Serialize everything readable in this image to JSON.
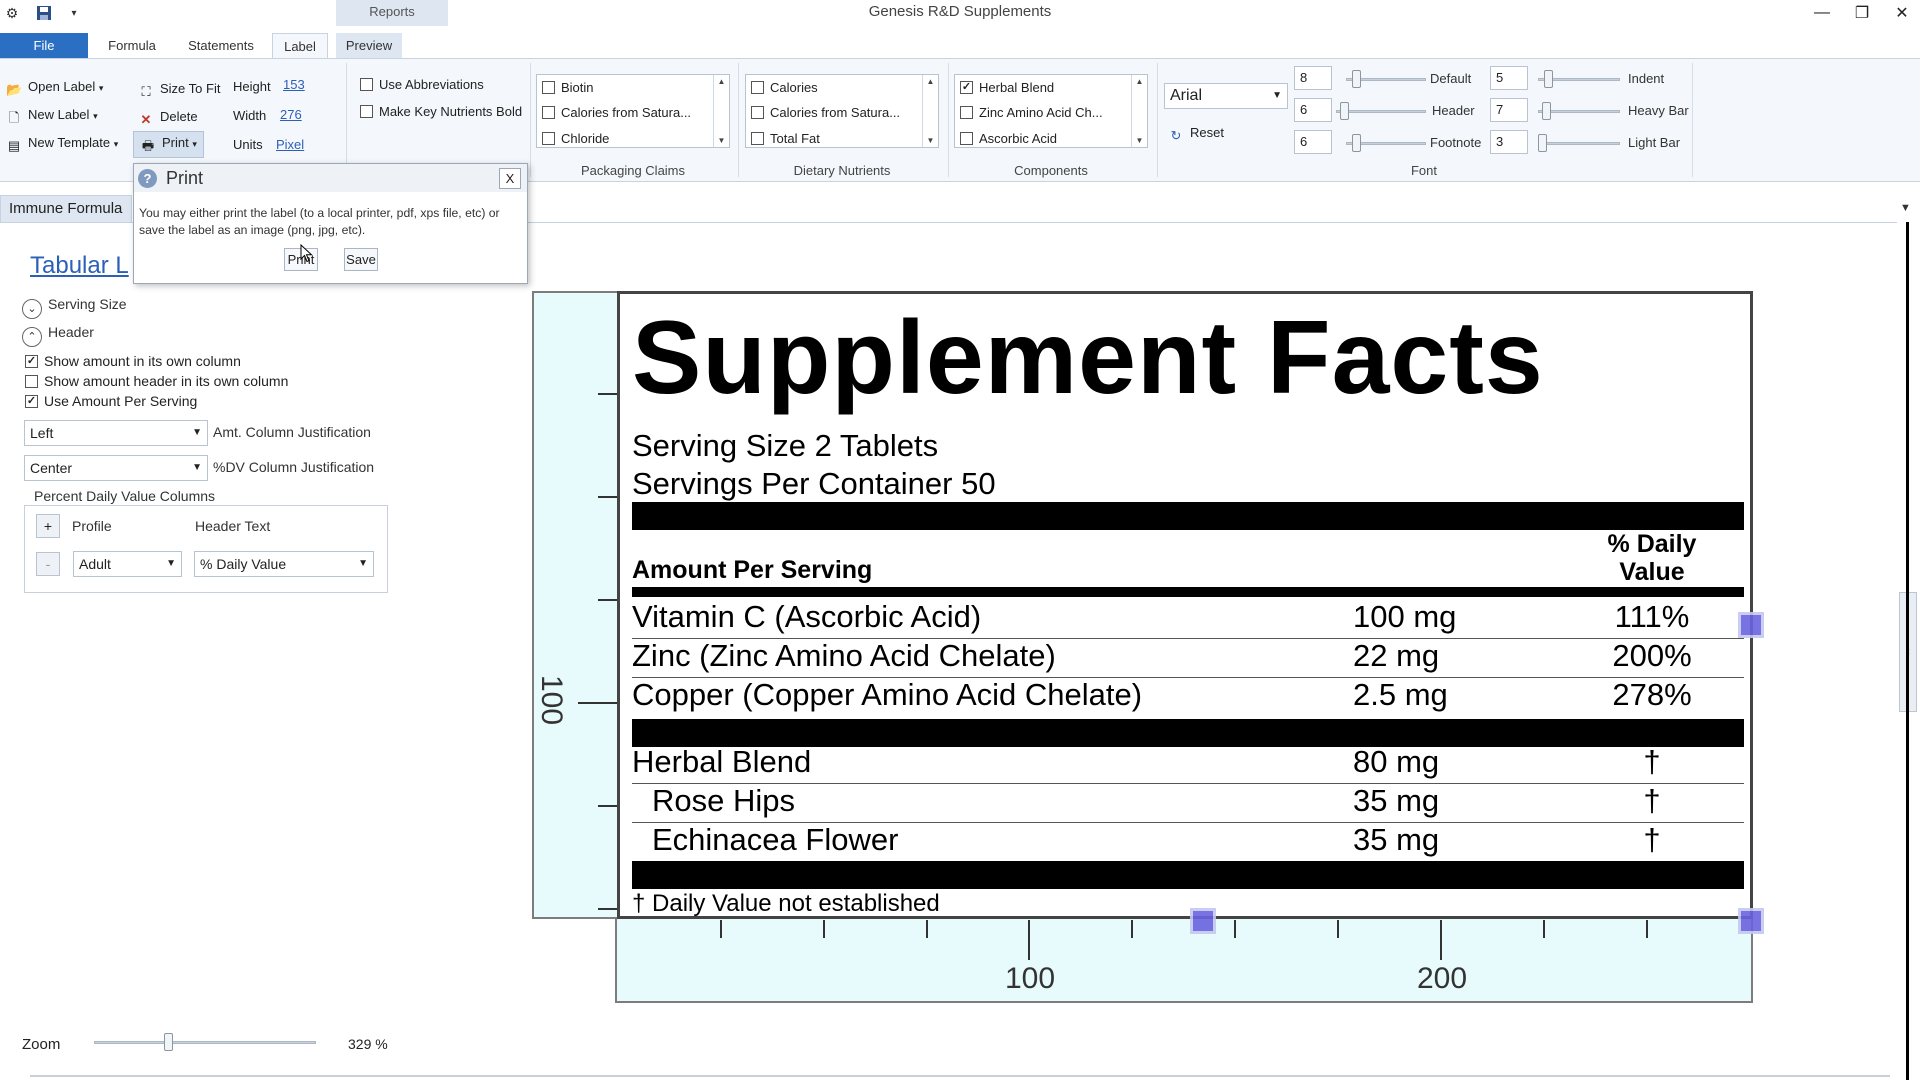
{
  "app": {
    "title": "Genesis R&D Supplements",
    "context_tab": "Reports",
    "window_controls": [
      "minimize-icon",
      "restore-icon",
      "close-icon"
    ]
  },
  "ribbon_tabs": [
    "File",
    "Formula",
    "Statements",
    "Label",
    "Preview"
  ],
  "active_tab": "Label",
  "ribbon": {
    "label_group": {
      "open_label": "Open Label",
      "new_label": "New Label",
      "new_template": "New Template",
      "size_to_fit": "Size To Fit",
      "delete": "Delete",
      "print": "Print",
      "height_label": "Height",
      "height_value": "153",
      "width_label": "Width",
      "width_value": "276",
      "units_label": "Units",
      "units_value": "Pixel"
    },
    "options": {
      "use_abbreviations": "Use Abbreviations",
      "make_key_nutrients_bold": "Make Key Nutrients Bold"
    },
    "packaging_claims": {
      "title": "Packaging Claims",
      "items": [
        {
          "label": "Biotin",
          "checked": false
        },
        {
          "label": "Calories from Satura...",
          "checked": false
        },
        {
          "label": "Chloride",
          "checked": false
        }
      ]
    },
    "dietary_nutrients": {
      "title": "Dietary Nutrients",
      "items": [
        {
          "label": "Calories",
          "checked": false
        },
        {
          "label": "Calories from Satura...",
          "checked": false
        },
        {
          "label": "Total Fat",
          "checked": false
        }
      ]
    },
    "components": {
      "title": "Components",
      "items": [
        {
          "label": "Herbal Blend",
          "checked": true
        },
        {
          "label": "Zinc Amino Acid Ch...",
          "checked": false
        },
        {
          "label": "Ascorbic Acid",
          "checked": false
        }
      ]
    },
    "font": {
      "title": "Font",
      "family": "Arial",
      "reset": "Reset",
      "sizes": [
        {
          "value": "8",
          "label": "Default"
        },
        {
          "value": "6",
          "label": "Header"
        },
        {
          "value": "6",
          "label": "Footnote"
        }
      ],
      "bars": [
        {
          "value": "5",
          "label": "Indent"
        },
        {
          "value": "7",
          "label": "Heavy Bar"
        },
        {
          "value": "3",
          "label": "Light Bar"
        }
      ]
    }
  },
  "document_tab": "Immune Formula",
  "left_panel": {
    "title": "Tabular L",
    "serving_size": "Serving Size",
    "header": "Header",
    "checkboxes": [
      {
        "label": "Show amount in its own column",
        "checked": true
      },
      {
        "label": "Show amount header in its own column",
        "checked": false
      },
      {
        "label": "Use Amount Per Serving",
        "checked": true
      }
    ],
    "amt_justification_value": "Left",
    "amt_justification_label": "Amt. Column Justification",
    "dv_justification_value": "Center",
    "dv_justification_label": "%DV Column Justification",
    "pdv_group_title": "Percent Daily Value Columns",
    "add_button": "+",
    "remove_button": "-",
    "profile_header": "Profile",
    "header_text_header": "Header Text",
    "profile_value": "Adult",
    "header_text_value": "% Daily Value",
    "zoom_label": "Zoom",
    "zoom_value": "329 %",
    "zoom_level": 0.33
  },
  "dialog": {
    "title": "Print",
    "close": "X",
    "message": "You may either print the label (to a local printer, pdf, xps file, etc) or save the label as an image (png, jpg, etc).",
    "print_button": "Print",
    "save_button": "Save"
  },
  "label": {
    "title": "Supplement Facts",
    "serving_size": "Serving Size 2 Tablets",
    "servings_per_container": "Servings Per Container 50",
    "amount_per_serving": "Amount Per Serving",
    "dv_header_line1": "% Daily",
    "dv_header_line2": "Value",
    "nutrients": [
      {
        "name": "Vitamin C (Ascorbic Acid)",
        "amount": "100 mg",
        "dv": "111%"
      },
      {
        "name": "Zinc (Zinc Amino Acid Chelate)",
        "amount": "22 mg",
        "dv": "200%"
      },
      {
        "name": "Copper (Copper Amino Acid Chelate)",
        "amount": "2.5 mg",
        "dv": "278%"
      }
    ],
    "blend": [
      {
        "name": "Herbal Blend",
        "amount": "80 mg",
        "dv": "†"
      },
      {
        "name": "Rose Hips",
        "amount": "35 mg",
        "dv": "†"
      },
      {
        "name": "Echinacea Flower",
        "amount": "35 mg",
        "dv": "†"
      }
    ],
    "footnote": "† Daily Value not established"
  },
  "rulers": {
    "vertical_label": "100",
    "horizontal_labels": [
      "100",
      "200"
    ]
  }
}
